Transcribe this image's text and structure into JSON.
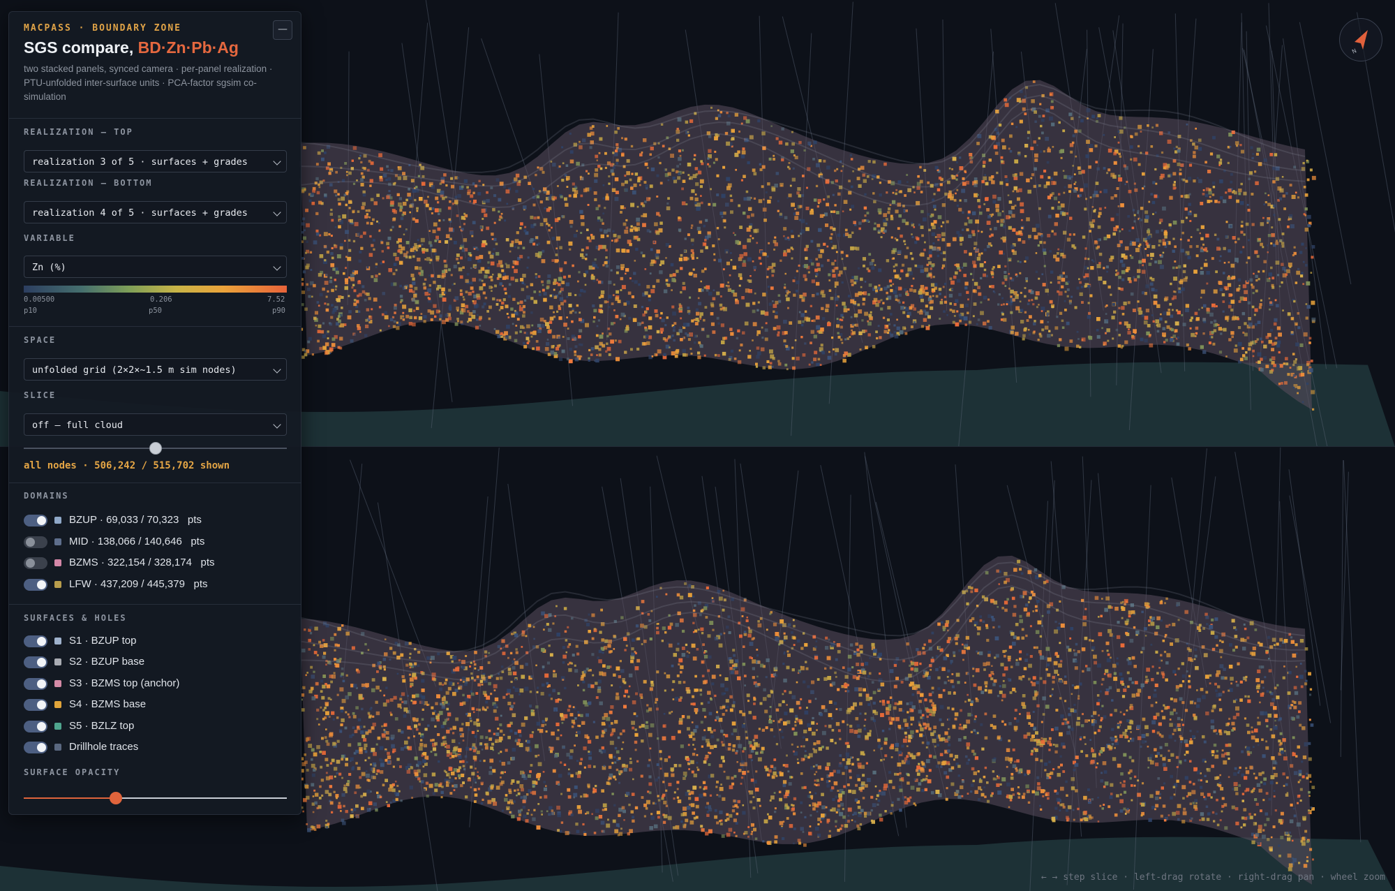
{
  "header": {
    "kicker": "MACPASS · BOUNDARY ZONE",
    "title": "SGS compare, ",
    "title_accent": "BD·Zn·Pb·Ag",
    "subtitle": "two stacked panels, synced camera · per-panel realization · PTU-unfolded inter-surface units · PCA-factor sgsim co-simulation",
    "minimize_label": "—"
  },
  "realization_top": {
    "label": "REALIZATION — TOP",
    "value": "realization 3 of 5 · surfaces + grades"
  },
  "realization_bottom": {
    "label": "REALIZATION — BOTTOM",
    "value": "realization 4 of 5 · surfaces + grades"
  },
  "variable": {
    "label": "VARIABLE",
    "value": "Zn (%)",
    "ramp_values": [
      "0.00500",
      "0.206",
      "7.52"
    ],
    "ramp_percentiles": [
      "p10",
      "p50",
      "p90"
    ]
  },
  "space": {
    "label": "SPACE",
    "value": "unfolded grid (2×2×~1.5 m sim nodes)"
  },
  "slice": {
    "label": "SLICE",
    "value": "off — full cloud",
    "position_fraction": 0.5,
    "status": "all nodes · 506,242 / 515,702 shown"
  },
  "domains": {
    "label": "DOMAINS",
    "items": [
      {
        "name": "BZUP",
        "count": "69,033 / 70,323",
        "unit": "pts",
        "on": true,
        "color": "#8fa8c8"
      },
      {
        "name": "MID",
        "count": "138,066 / 140,646",
        "unit": "pts",
        "on": false,
        "color": "#5e6e8c"
      },
      {
        "name": "BZMS",
        "count": "322,154 / 328,174",
        "unit": "pts",
        "on": false,
        "color": "#d487a8"
      },
      {
        "name": "LFW",
        "count": "437,209 / 445,379",
        "unit": "pts",
        "on": true,
        "color": "#b89d4c"
      }
    ]
  },
  "surfaces": {
    "label": "SURFACES & HOLES",
    "items": [
      {
        "label": "S1 · BZUP top",
        "on": true,
        "color": "#9fb2cc"
      },
      {
        "label": "S2 · BZUP base",
        "on": true,
        "color": "#a9acb3"
      },
      {
        "label": "S3 · BZMS top (anchor)",
        "on": true,
        "color": "#d48aa6"
      },
      {
        "label": "S4 · BZMS base",
        "on": true,
        "color": "#e0a43a"
      },
      {
        "label": "S5 · BZLZ top",
        "on": true,
        "color": "#4fa58e"
      },
      {
        "label": "Drillhole traces",
        "on": true,
        "color": "#5a6880"
      }
    ]
  },
  "surface_opacity": {
    "label": "SURFACE OPACITY",
    "value_fraction": 0.35
  },
  "compass": {
    "label": "N"
  },
  "hint": "← → step slice · left-drag rotate · right-drag pan · wheel zoom",
  "colors": {
    "background": "#0d1119",
    "accent": "#e5683f",
    "kicker": "#e0a347",
    "toggle_on": "#4d5f82"
  }
}
